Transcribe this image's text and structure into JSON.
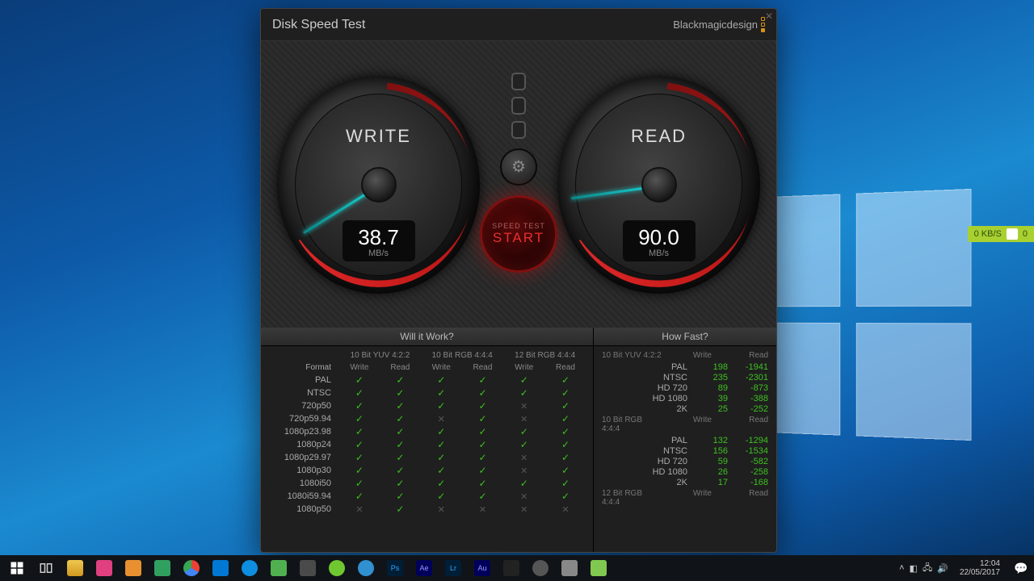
{
  "app": {
    "title": "Disk Speed Test",
    "brand": "Blackmagicdesign"
  },
  "gauges": {
    "write": {
      "label": "WRITE",
      "value": "38.7",
      "unit": "MB/s",
      "needle_angle": 148
    },
    "read": {
      "label": "READ",
      "value": "90.0",
      "unit": "MB/s",
      "needle_angle": 172
    }
  },
  "center": {
    "speed_test_label": "SPEED TEST",
    "start_label": "START"
  },
  "results": {
    "will_title": "Will it Work?",
    "fast_title": "How Fast?",
    "col_groups": [
      "10 Bit YUV 4:2:2",
      "10 Bit RGB 4:4:4",
      "12 Bit RGB 4:4:4"
    ],
    "subcols": [
      "Write",
      "Read"
    ],
    "format_label": "Format",
    "formats": [
      {
        "name": "PAL",
        "cells": [
          1,
          1,
          1,
          1,
          1,
          1
        ]
      },
      {
        "name": "NTSC",
        "cells": [
          1,
          1,
          1,
          1,
          1,
          1
        ]
      },
      {
        "name": "720p50",
        "cells": [
          1,
          1,
          1,
          1,
          0,
          1
        ]
      },
      {
        "name": "720p59.94",
        "cells": [
          1,
          1,
          0,
          1,
          0,
          1
        ]
      },
      {
        "name": "1080p23.98",
        "cells": [
          1,
          1,
          1,
          1,
          1,
          1
        ]
      },
      {
        "name": "1080p24",
        "cells": [
          1,
          1,
          1,
          1,
          1,
          1
        ]
      },
      {
        "name": "1080p29.97",
        "cells": [
          1,
          1,
          1,
          1,
          0,
          1
        ]
      },
      {
        "name": "1080p30",
        "cells": [
          1,
          1,
          1,
          1,
          0,
          1
        ]
      },
      {
        "name": "1080i50",
        "cells": [
          1,
          1,
          1,
          1,
          1,
          1
        ]
      },
      {
        "name": "1080i59.94",
        "cells": [
          1,
          1,
          1,
          1,
          0,
          1
        ]
      },
      {
        "name": "1080p50",
        "cells": [
          0,
          1,
          0,
          0,
          0,
          0
        ]
      }
    ],
    "fast_groups": [
      {
        "name": "10 Bit YUV 4:2:2",
        "rows": [
          {
            "label": "PAL",
            "write": "198",
            "read": "-1941"
          },
          {
            "label": "NTSC",
            "write": "235",
            "read": "-2301"
          },
          {
            "label": "HD 720",
            "write": "89",
            "read": "-873"
          },
          {
            "label": "HD 1080",
            "write": "39",
            "read": "-388"
          },
          {
            "label": "2K",
            "write": "25",
            "read": "-252"
          }
        ]
      },
      {
        "name": "10 Bit RGB 4:4:4",
        "rows": [
          {
            "label": "PAL",
            "write": "132",
            "read": "-1294"
          },
          {
            "label": "NTSC",
            "write": "156",
            "read": "-1534"
          },
          {
            "label": "HD 720",
            "write": "59",
            "read": "-582"
          },
          {
            "label": "HD 1080",
            "write": "26",
            "read": "-258"
          },
          {
            "label": "2K",
            "write": "17",
            "read": "-168"
          }
        ]
      },
      {
        "name": "12 Bit RGB 4:4:4",
        "rows": []
      }
    ],
    "fast_write_hdr": "Write",
    "fast_read_hdr": "Read"
  },
  "taskbar": {
    "time": "12:04",
    "date": "22/05/2017"
  },
  "netwidget": {
    "speed": "0 KB/S",
    "count": "0"
  }
}
